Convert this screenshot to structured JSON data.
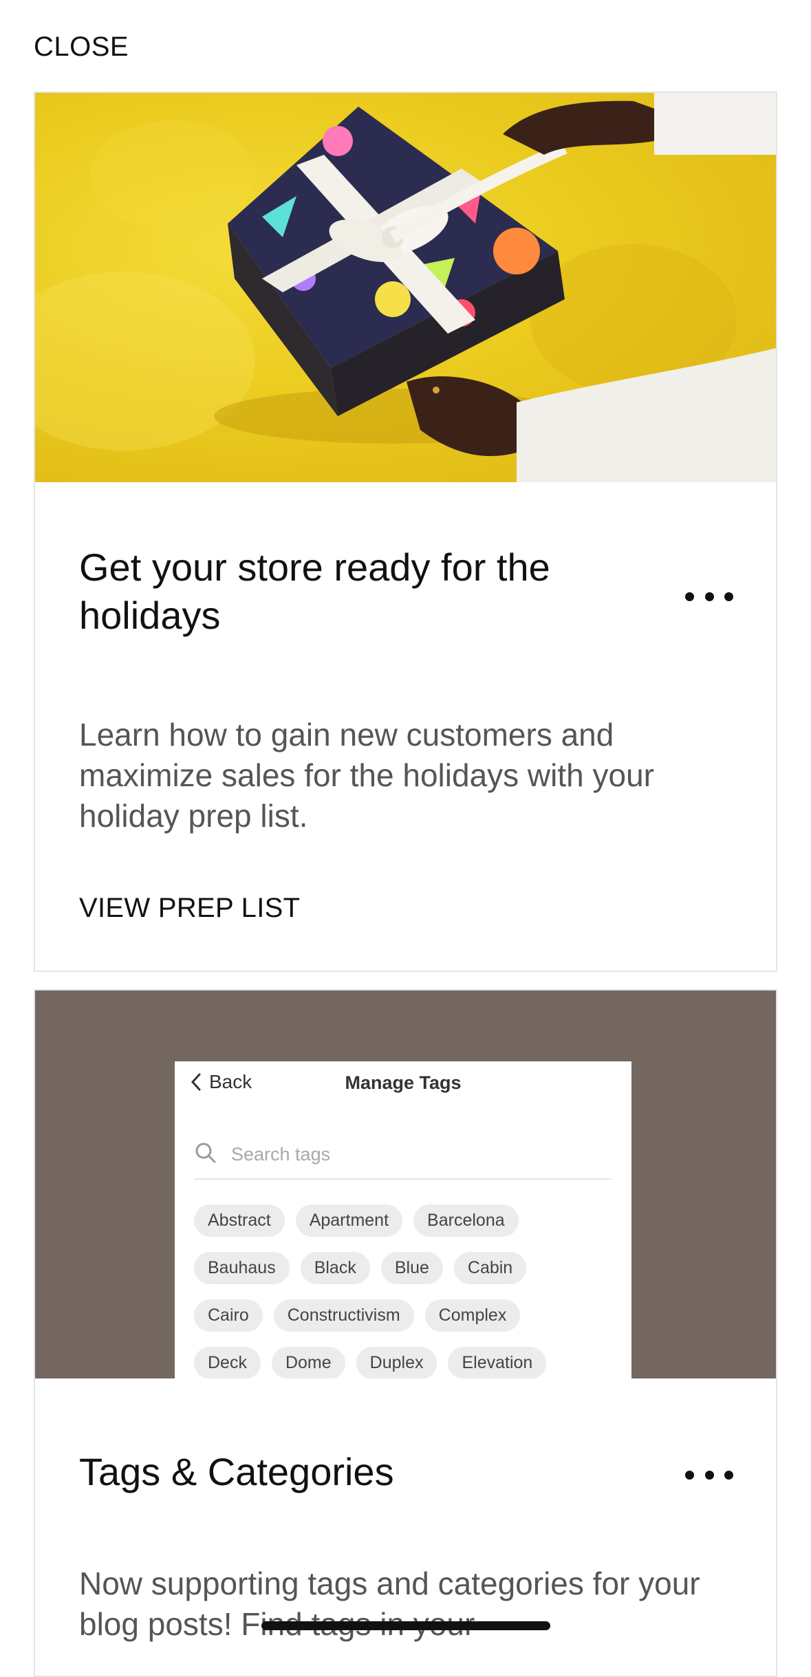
{
  "header": {
    "close_label": "CLOSE"
  },
  "cards": [
    {
      "title": "Get your store ready for the holidays",
      "description": "Learn how to gain new customers and maximize sales for the holidays with your holiday prep list.",
      "cta_label": "VIEW PREP LIST"
    },
    {
      "title": "Tags & Categories",
      "description": "Now supporting tags and categories for your blog posts! Find tags in your",
      "mockup": {
        "back_label": "Back",
        "title": "Manage Tags",
        "search_placeholder": "Search tags",
        "tag_rows": [
          [
            "Abstract",
            "Apartment",
            "Barcelona"
          ],
          [
            "Bauhaus",
            "Black",
            "Blue",
            "Cabin"
          ],
          [
            "Cairo",
            "Constructivism",
            "Complex"
          ],
          [
            "Deck",
            "Dome",
            "Duplex",
            "Elevation"
          ]
        ]
      }
    }
  ],
  "colors": {
    "hero1_background": "#ebcb1e",
    "hero2_background": "#736760",
    "title_text": "#111111",
    "body_text": "#555555",
    "tag_chip": "#ececec"
  },
  "icons": [
    "more-horizontal-icon",
    "chevron-left-icon",
    "search-icon"
  ]
}
